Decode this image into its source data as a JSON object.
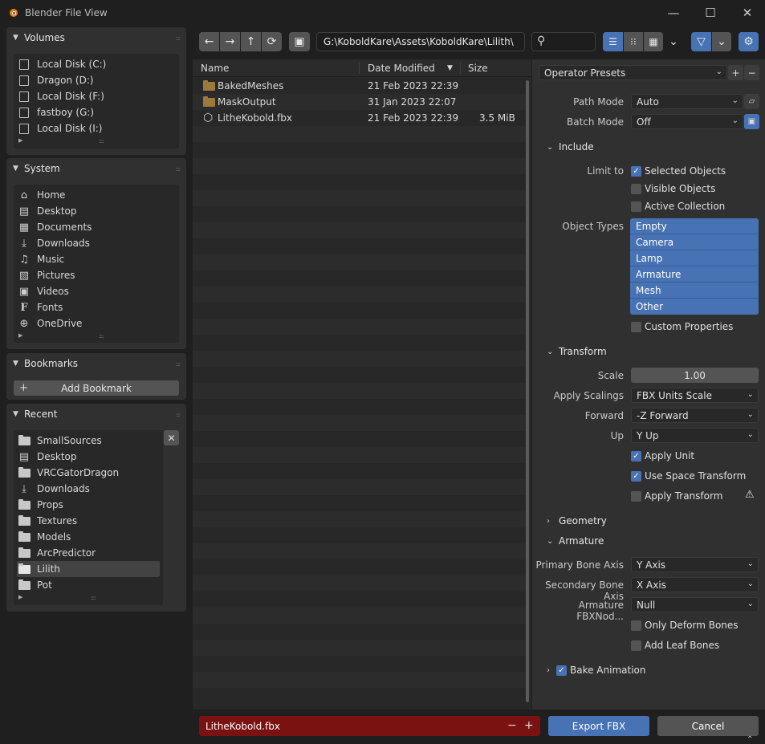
{
  "window": {
    "title": "Blender File View",
    "minimize_glyph": "—",
    "maximize_glyph": "☐",
    "close_glyph": "✕"
  },
  "sidebar": {
    "volumes": {
      "title": "Volumes",
      "items": [
        {
          "label": "Local Disk (C:)",
          "icon": "drive-icon"
        },
        {
          "label": "Dragon (D:)",
          "icon": "drive-icon"
        },
        {
          "label": "Local Disk (F:)",
          "icon": "drive-icon"
        },
        {
          "label": "fastboy (G:)",
          "icon": "drive-icon"
        },
        {
          "label": "Local Disk (I:)",
          "icon": "drive-icon"
        }
      ]
    },
    "system": {
      "title": "System",
      "items": [
        {
          "label": "Home",
          "icon": "home-icon",
          "glyph": "⌂"
        },
        {
          "label": "Desktop",
          "icon": "desktop-icon",
          "glyph": "▤"
        },
        {
          "label": "Documents",
          "icon": "documents-icon",
          "glyph": "▦"
        },
        {
          "label": "Downloads",
          "icon": "downloads-icon",
          "glyph": "⤓"
        },
        {
          "label": "Music",
          "icon": "music-icon",
          "glyph": "♫"
        },
        {
          "label": "Pictures",
          "icon": "pictures-icon",
          "glyph": "▧"
        },
        {
          "label": "Videos",
          "icon": "videos-icon",
          "glyph": "▣"
        },
        {
          "label": "Fonts",
          "icon": "fonts-icon",
          "glyph": "F"
        },
        {
          "label": "OneDrive",
          "icon": "onedrive-icon",
          "glyph": "⊕"
        }
      ]
    },
    "bookmarks": {
      "title": "Bookmarks",
      "add_label": "Add Bookmark"
    },
    "recent": {
      "title": "Recent",
      "items": [
        {
          "label": "SmallSources",
          "icon": "folder-icon"
        },
        {
          "label": "Desktop",
          "icon": "desktop-icon"
        },
        {
          "label": "VRCGatorDragon",
          "icon": "folder-icon"
        },
        {
          "label": "Downloads",
          "icon": "downloads-icon"
        },
        {
          "label": "Props",
          "icon": "folder-icon"
        },
        {
          "label": "Textures",
          "icon": "folder-icon"
        },
        {
          "label": "Models",
          "icon": "folder-icon"
        },
        {
          "label": "ArcPredictor",
          "icon": "folder-icon"
        },
        {
          "label": "Lilith",
          "icon": "folder-icon",
          "selected": true
        },
        {
          "label": "Pot",
          "icon": "folder-icon"
        }
      ]
    }
  },
  "toolbar": {
    "back_glyph": "←",
    "forward_glyph": "→",
    "parent_glyph": "↑",
    "refresh_glyph": "⟳",
    "new_folder_glyph": "▣",
    "path": "G:\\KoboldKare\\Assets\\KoboldKare\\Lilith\\",
    "search_glyph": "⚲",
    "filter_glyph": "▽",
    "settings_glyph": "⚙",
    "dropdown_glyph": "⌄"
  },
  "file_list": {
    "columns": {
      "name": "Name",
      "date": "Date Modified",
      "size": "Size",
      "sort_glyph": "▼"
    },
    "rows": [
      {
        "name": "BakedMeshes",
        "date": "21 Feb 2023 22:39",
        "size": "",
        "type": "folder"
      },
      {
        "name": "MaskOutput",
        "date": "31 Jan 2023 22:07",
        "size": "",
        "type": "folder"
      },
      {
        "name": "LitheKobold.fbx",
        "date": "21 Feb 2023 22:39",
        "size": "3.5 MiB",
        "type": "file"
      }
    ]
  },
  "options": {
    "presets_label": "Operator Presets",
    "path_mode_label": "Path Mode",
    "path_mode_value": "Auto",
    "batch_mode_label": "Batch Mode",
    "batch_mode_value": "Off",
    "include": {
      "title": "Include",
      "limit_to_label": "Limit to",
      "selected_objects": "Selected Objects",
      "visible_objects": "Visible Objects",
      "active_collection": "Active Collection",
      "object_types_label": "Object Types",
      "object_types": [
        "Empty",
        "Camera",
        "Lamp",
        "Armature",
        "Mesh",
        "Other"
      ],
      "custom_properties": "Custom Properties"
    },
    "transform": {
      "title": "Transform",
      "scale_label": "Scale",
      "scale_value": "1.00",
      "apply_scalings_label": "Apply Scalings",
      "apply_scalings_value": "FBX Units Scale",
      "forward_label": "Forward",
      "forward_value": "-Z Forward",
      "up_label": "Up",
      "up_value": "Y Up",
      "apply_unit": "Apply Unit",
      "use_space_transform": "Use Space Transform",
      "apply_transform": "Apply Transform",
      "warning_glyph": "⚠"
    },
    "geometry": {
      "title": "Geometry"
    },
    "armature": {
      "title": "Armature",
      "primary_bone_axis_label": "Primary Bone Axis",
      "primary_bone_axis_value": "Y Axis",
      "secondary_bone_axis_label": "Secondary Bone Axis",
      "secondary_bone_axis_value": "X Axis",
      "fbx_node_label": "Armature FBXNod...",
      "fbx_node_value": "Null",
      "only_deform_bones": "Only Deform Bones",
      "add_leaf_bones": "Add Leaf Bones"
    },
    "bake_animation": {
      "title": "Bake Animation"
    }
  },
  "footer": {
    "filename": "LitheKobold.fbx",
    "minus_glyph": "−",
    "plus_glyph": "+",
    "export_label": "Export FBX",
    "cancel_label": "Cancel"
  },
  "colors": {
    "accent": "#4772b3",
    "filename_bg": "#7a1212",
    "folder": "#9c7a3c"
  }
}
